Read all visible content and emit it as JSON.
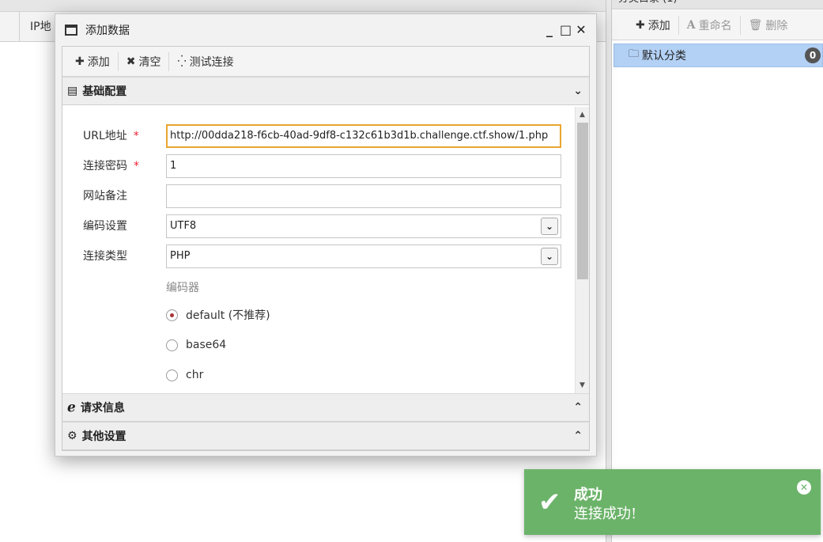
{
  "background": {
    "column_header": "IP地"
  },
  "right_panel": {
    "title": "分类目录 (1)",
    "toolbar": {
      "add_label": "添加",
      "rename_label": "重命名",
      "delete_label": "删除"
    },
    "categories": [
      {
        "label": "默认分类",
        "count": "0"
      }
    ]
  },
  "dialog": {
    "title": "添加数据",
    "controls": {
      "minimize": "_",
      "maximize": "□",
      "close": "✕"
    },
    "toolbar": {
      "add_label": "添加",
      "clear_label": "清空",
      "test_label": "测试连接"
    },
    "sections": {
      "basic": "基础配置",
      "request": "请求信息",
      "other": "其他设置"
    },
    "form": {
      "url_label": "URL地址",
      "url_value": "http://00dda218-f6cb-40ad-9df8-c132c61b3d1b.challenge.ctf.show/1.php",
      "password_label": "连接密码",
      "password_value": "1",
      "note_label": "网站备注",
      "note_value": "",
      "encoding_label": "编码设置",
      "encoding_value": "UTF8",
      "type_label": "连接类型",
      "type_value": "PHP",
      "encoder_title": "编码器",
      "encoders": [
        {
          "label": "default (不推荐)",
          "checked": true
        },
        {
          "label": "base64",
          "checked": false
        },
        {
          "label": "chr",
          "checked": false
        }
      ],
      "required_mark": "*"
    }
  },
  "toast": {
    "title": "成功",
    "message": "连接成功!",
    "icon": "check-icon",
    "color": "#6cb36a"
  }
}
